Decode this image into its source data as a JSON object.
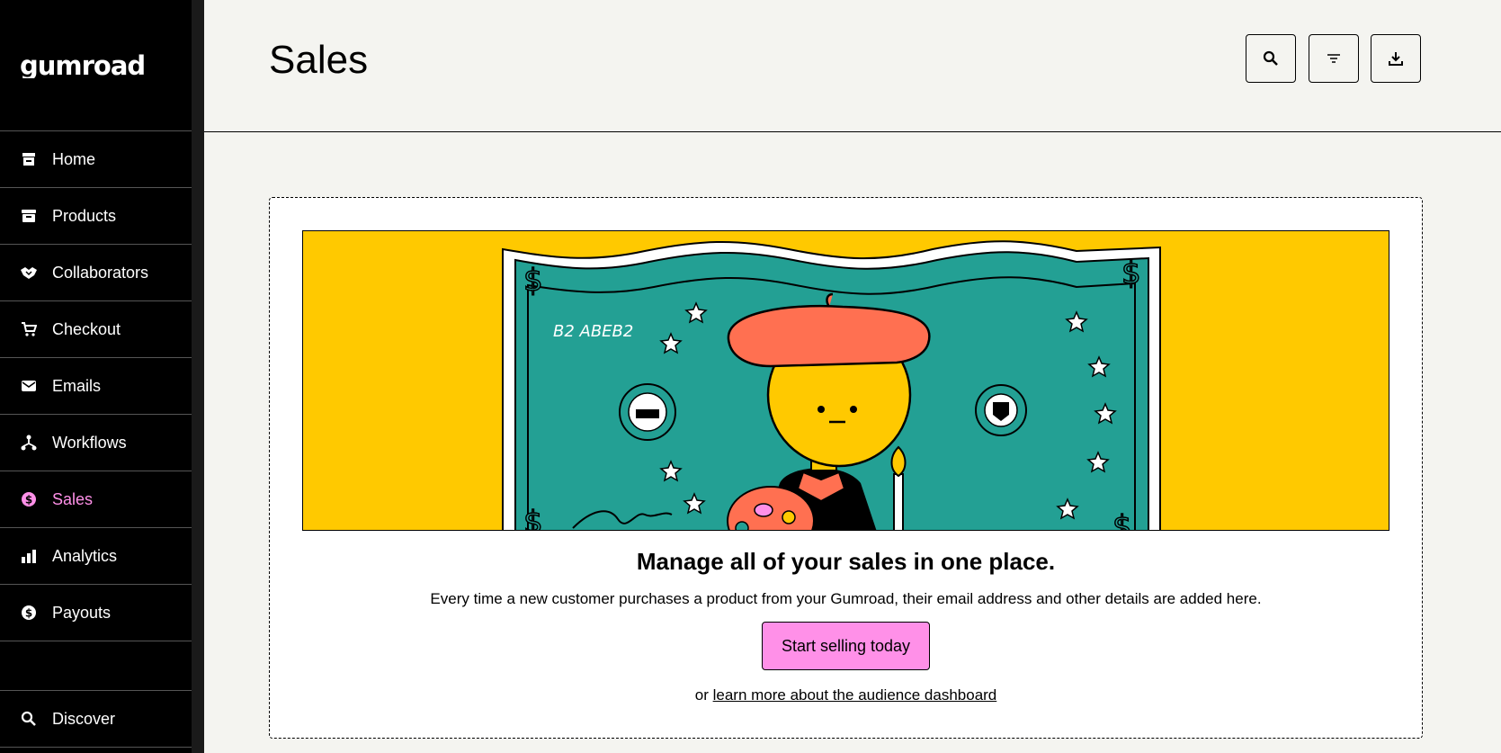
{
  "app": {
    "logo": "GUMROAD"
  },
  "sidebar": {
    "items": [
      {
        "label": "Home",
        "icon": "store-icon"
      },
      {
        "label": "Products",
        "icon": "archive-icon"
      },
      {
        "label": "Collaborators",
        "icon": "handshake-icon"
      },
      {
        "label": "Checkout",
        "icon": "cart-icon"
      },
      {
        "label": "Emails",
        "icon": "envelope-icon"
      },
      {
        "label": "Workflows",
        "icon": "workflow-icon"
      },
      {
        "label": "Sales",
        "icon": "dollar-circle-icon",
        "active": true
      },
      {
        "label": "Analytics",
        "icon": "bar-chart-icon"
      },
      {
        "label": "Payouts",
        "icon": "dollar-circle-icon"
      }
    ],
    "bottom": {
      "label": "Discover",
      "icon": "search-icon"
    }
  },
  "header": {
    "title": "Sales",
    "buttons": [
      "search-icon",
      "filter-icon",
      "download-icon"
    ]
  },
  "empty_state": {
    "title": "Manage all of your sales in one place.",
    "description": "Every time a new customer purchases a product from your Gumroad, their email address and other details are added here.",
    "cta_label": "Start selling today",
    "footer_prefix": "or",
    "footer_link": "learn more about the audience dashboard",
    "banner_text": "B2  ABEB2"
  },
  "colors": {
    "accent_pink": "#ff90e8",
    "banner_yellow": "#ffc900",
    "bill_teal": "#23a094",
    "beret_red": "#ff7051"
  }
}
